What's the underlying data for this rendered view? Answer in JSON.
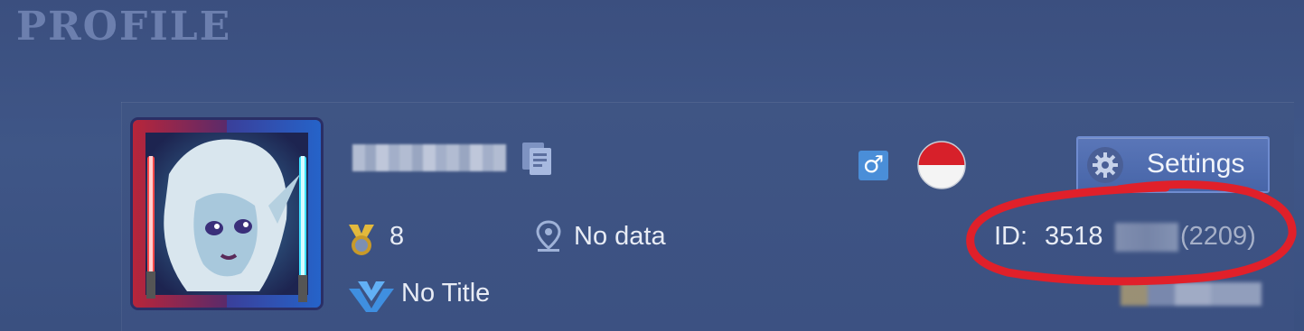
{
  "header": {
    "title": "PROFILE"
  },
  "profile": {
    "level": "8",
    "location": "No data",
    "title": "No Title",
    "gender_symbol": "♂",
    "id_label": "ID:",
    "id_value": "3518",
    "id_zone": "(2209)"
  },
  "settings": {
    "label": "Settings"
  },
  "icons": {
    "copy": "copy-icon",
    "gender": "male-icon",
    "flag": "flag-icon",
    "gear": "gear-icon",
    "medal": "medal-icon",
    "location": "location-pin-icon",
    "title": "title-emblem-icon"
  },
  "colors": {
    "background": "#3d5283",
    "text": "#e8ecf5",
    "settings_button": "#4f6db0",
    "annotation": "#e0202a"
  }
}
